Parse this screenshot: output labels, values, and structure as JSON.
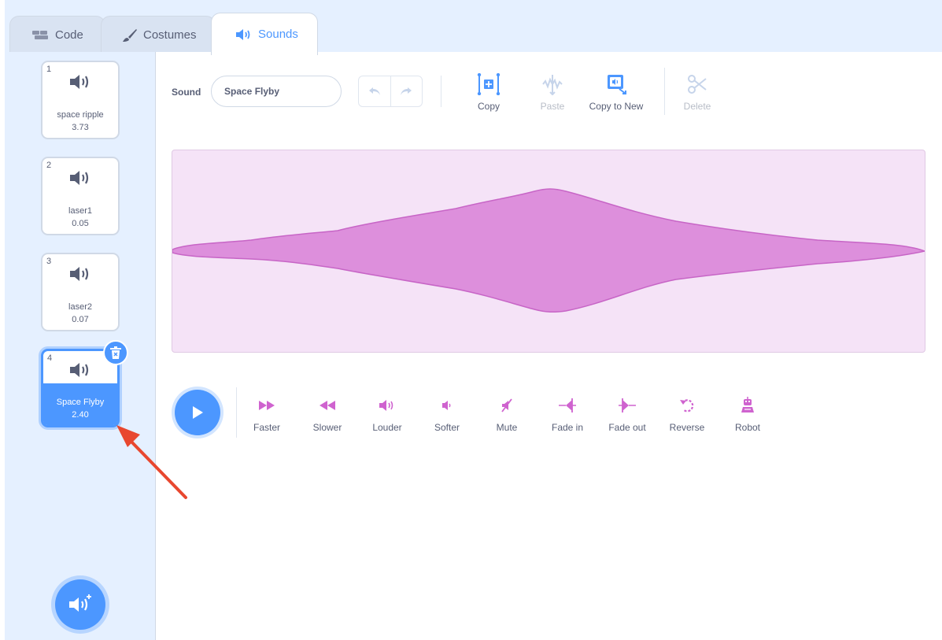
{
  "tabs": [
    {
      "label": "Code",
      "icon": "code-icon"
    },
    {
      "label": "Costumes",
      "icon": "brush-icon"
    },
    {
      "label": "Sounds",
      "icon": "speaker-icon",
      "active": true
    }
  ],
  "sounds": [
    {
      "index": "1",
      "name": "space ripple",
      "duration": "3.73"
    },
    {
      "index": "2",
      "name": "laser1",
      "duration": "0.05"
    },
    {
      "index": "3",
      "name": "laser2",
      "duration": "0.07"
    },
    {
      "index": "4",
      "name": "Space Flyby",
      "duration": "2.40",
      "selected": true
    }
  ],
  "editor": {
    "sound_label": "Sound",
    "sound_name": "Space Flyby",
    "tools": {
      "copy": "Copy",
      "paste": "Paste",
      "copy_to_new": "Copy to New",
      "delete": "Delete"
    },
    "effects": {
      "faster": "Faster",
      "slower": "Slower",
      "louder": "Louder",
      "softer": "Softer",
      "mute": "Mute",
      "fade_in": "Fade in",
      "fade_out": "Fade out",
      "reverse": "Reverse",
      "robot": "Robot"
    }
  },
  "colors": {
    "accent": "#4c97ff",
    "sound_magenta": "#cf63cf",
    "wave_fill": "#dd8fdc",
    "wave_bg": "#f5e3f7",
    "annotation_arrow": "#e8472f"
  }
}
